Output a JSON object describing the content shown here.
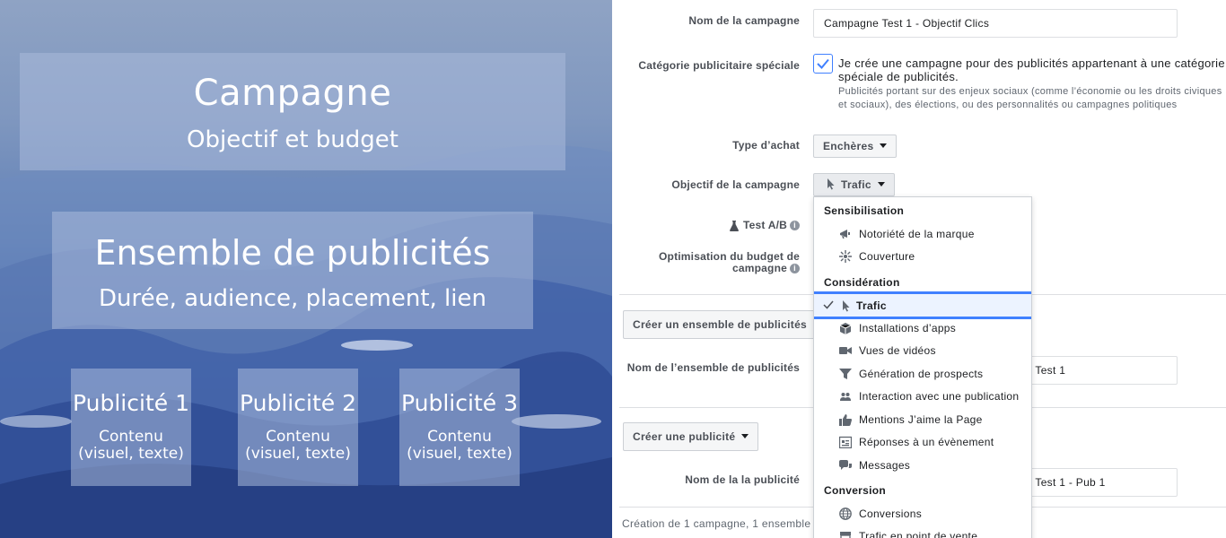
{
  "hierarchy": {
    "campagne": {
      "title": "Campagne",
      "subtitle": "Objectif et budget"
    },
    "ensemble": {
      "title": "Ensemble de publicités",
      "subtitle": "Durée, audience, placement, lien"
    },
    "publicites": [
      {
        "title": "Publicité 1",
        "content": "Contenu\n(visuel, texte)"
      },
      {
        "title": "Publicité 2",
        "content": "Contenu\n(visuel, texte)"
      },
      {
        "title": "Publicité 3",
        "content": "Contenu\n(visuel, texte)"
      }
    ]
  },
  "form": {
    "campaign_name_label": "Nom de la campagne",
    "campaign_name_value": "Campagne Test 1 - Objectif Clics",
    "special_category_label": "Catégorie publicitaire spéciale",
    "special_category_checked": true,
    "special_category_text": "Je crée une campagne pour des publicités appartenant à une catégorie spéciale de publicités.",
    "special_category_sub": "Publicités portant sur des enjeux sociaux (comme l’économie ou les droits civiques et sociaux), des élections, ou des personnalités ou campagnes politiques",
    "buying_type_label": "Type d’achat",
    "buying_type_value": "Enchères",
    "objective_label": "Objectif de la campagne",
    "objective_value": "Trafic",
    "ab_test_label": "Test A/B",
    "budget_opt_label_1": "Optimisation du budget de",
    "budget_opt_label_2": "campagne",
    "create_adset_button": "Créer un ensemble de publicités",
    "adset_name_label": "Nom de l’ensemble de publicités",
    "adset_name_value_visible": "e Test 1",
    "create_ad_button": "Créer une publicité",
    "ad_name_label": "Nom de la la publicité",
    "ad_name_value_visible": "e Test 1 - Pub 1",
    "footer_text": "Création de 1 campagne, 1 ensemble de"
  },
  "objective_menu": {
    "groups": [
      {
        "heading": "Sensibilisation",
        "items": [
          {
            "label": "Notoriété de la marque",
            "icon": "megaphone-icon"
          },
          {
            "label": "Couverture",
            "icon": "reach-icon"
          }
        ]
      },
      {
        "heading": "Considération",
        "items": [
          {
            "label": "Trafic",
            "icon": "cursor-icon",
            "selected": true
          },
          {
            "label": "Installations d’apps",
            "icon": "box-icon"
          },
          {
            "label": "Vues de vidéos",
            "icon": "video-icon"
          },
          {
            "label": "Génération de prospects",
            "icon": "funnel-icon"
          },
          {
            "label": "Interaction avec une publication",
            "icon": "people-icon"
          },
          {
            "label": "Mentions J’aime la Page",
            "icon": "thumbs-up-icon"
          },
          {
            "label": "Réponses à un évènement",
            "icon": "event-icon"
          },
          {
            "label": "Messages",
            "icon": "chat-icon"
          }
        ]
      },
      {
        "heading": "Conversion",
        "items": [
          {
            "label": "Conversions",
            "icon": "globe-icon"
          },
          {
            "label": "Trafic en point de vente",
            "icon": "store-icon"
          }
        ]
      }
    ]
  }
}
